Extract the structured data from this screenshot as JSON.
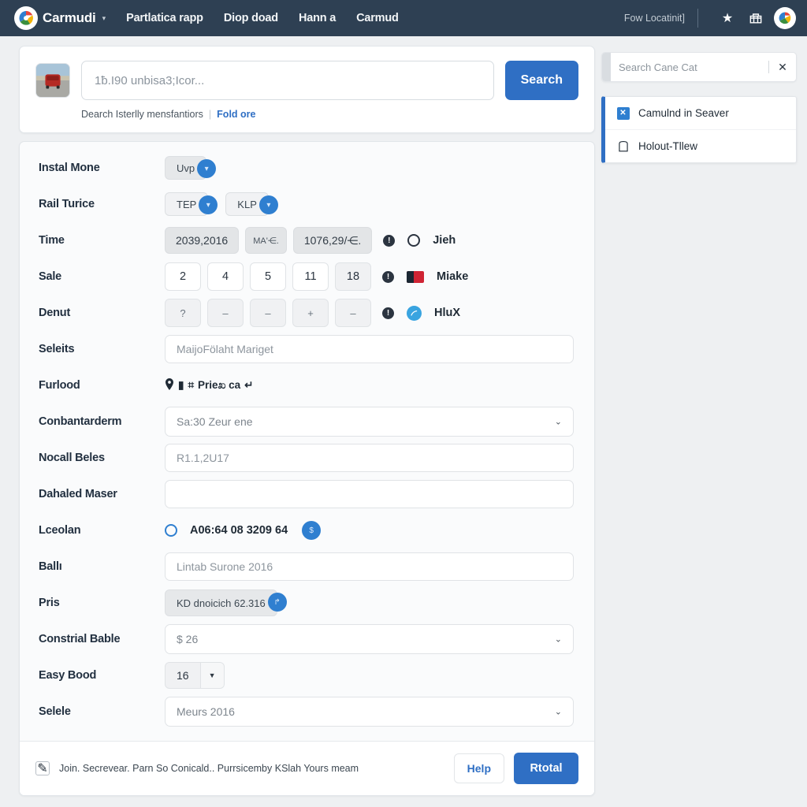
{
  "topnav": {
    "brand": "Carmudi",
    "brand_caret": "▾",
    "links": [
      {
        "label": "Partlatica rapp"
      },
      {
        "label": "Diop doad"
      },
      {
        "label": "Hann a"
      },
      {
        "label": "Carmud"
      }
    ],
    "location": "Fow Locatinit]",
    "icons": [
      {
        "name": "star-icon",
        "glyph": "★"
      },
      {
        "name": "shop-basket-icon",
        "glyph": "🛍"
      }
    ],
    "colors": {
      "bar": "#2e4053",
      "text": "#f2f5f7"
    }
  },
  "search": {
    "placeholder": "1ƀ.I90 unbisa3;Icor...",
    "value": "",
    "button_label": "Search",
    "sub_text": "Dearch Isterlly mensfantiors",
    "sub_separator": "|",
    "sub_link": "Fold ore",
    "thumbnail_name": "red-suv-photo",
    "accent": "#2f6fc4"
  },
  "sidebar": {
    "search_placeholder": "Search Cane Cat",
    "search_value": "",
    "close_glyph": "✕",
    "items": [
      {
        "label": "Camulnd in Seaver",
        "icon": "blue-square-icon",
        "icon_glyph": "✕"
      },
      {
        "label": "Holout-Tllew",
        "icon": "tag-outline-icon",
        "icon_glyph": ""
      }
    ],
    "accent": "#2f6fc4"
  },
  "form": {
    "rows": [
      {
        "label": "Instal Mone",
        "type": "chips",
        "chips": [
          {
            "text": "Uvp",
            "badge": "▾"
          }
        ]
      },
      {
        "label": "Rail Turice",
        "type": "chips",
        "chips": [
          {
            "text": "TEP",
            "badge": "▾"
          },
          {
            "text": "KLP",
            "badge": "▾"
          }
        ]
      },
      {
        "label": "Time",
        "type": "valueboxes",
        "boxes": [
          "2039,2016",
          "MA'⋲.",
          "1076,29/⋲."
        ],
        "info": "!",
        "marker": "radio",
        "marker_text": "Jieh"
      },
      {
        "label": "Sale",
        "type": "numbers",
        "numbers": [
          "2",
          "4",
          "5",
          "11",
          "18"
        ],
        "info": "!",
        "marker": "flag",
        "marker_text": "Miake"
      },
      {
        "label": "Denut",
        "type": "symbols",
        "symbols": [
          "?",
          "–",
          "–",
          "+",
          "–"
        ],
        "info": "!",
        "marker": "circle",
        "marker_text": "HluX"
      },
      {
        "label": "Seleits",
        "type": "input",
        "value": "MaijoFölaht Mariget"
      },
      {
        "label": "Furlood",
        "type": "meta",
        "meta_glyphs": "📍▮ ⛭",
        "meta_text": "Prieಖ ca",
        "meta_tail": "↵"
      },
      {
        "label": "Conbantarderm",
        "type": "select",
        "value": "Sa:30 Zeur ene",
        "chevron": "⌄"
      },
      {
        "label": "Nocall Beles",
        "type": "input",
        "value": "R1.1,2U17"
      },
      {
        "label": "Dahaled Maser",
        "type": "input",
        "value": ""
      },
      {
        "label": "Lceolan",
        "type": "radioline",
        "radio_text": "A06:64 08 3209 64",
        "badge": "$"
      },
      {
        "label": "Ballı",
        "type": "input",
        "value": "Lintab Surone 2016"
      },
      {
        "label": "Pris",
        "type": "chips",
        "chips": [
          {
            "text": "KD dnoicich 62.316",
            "badge": "↱"
          }
        ]
      },
      {
        "label": "Constrial Bable",
        "type": "select",
        "value": "$ 26",
        "chevron": "⌄"
      },
      {
        "label": "Easy Bood",
        "type": "stepper",
        "value": "16",
        "arrow": "▼"
      },
      {
        "label": "Selele",
        "type": "select",
        "value": "Meurs 2016",
        "chevron": "⌄"
      }
    ],
    "footer": {
      "checkbox_glyph": "✎",
      "text": "Join. Secrevear. Parn So Conicald.. Purrsicemby KSlah Yours meam",
      "help_label": "Help",
      "primary_label": "Rtotal"
    }
  }
}
